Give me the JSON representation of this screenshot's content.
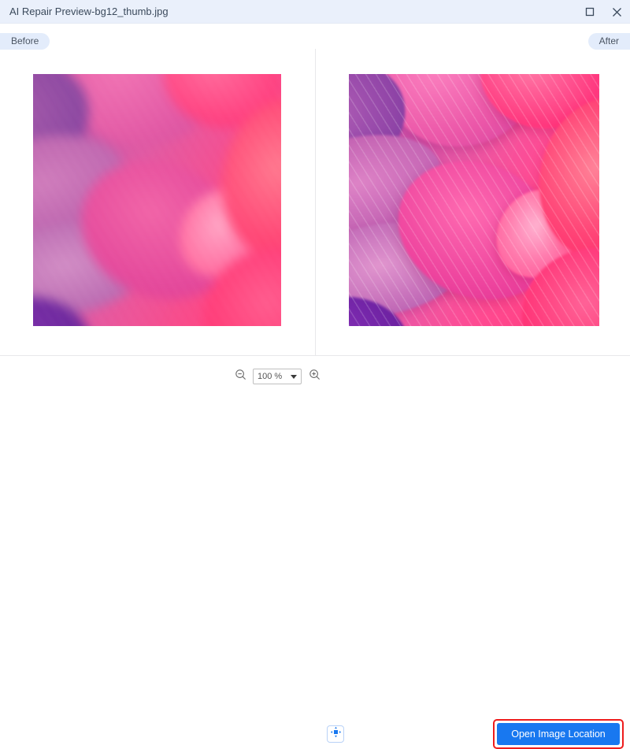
{
  "window": {
    "title": "AI Repair Preview-bg12_thumb.jpg",
    "maximize_icon": "maximize-square-icon",
    "close_icon": "close-x-icon"
  },
  "compare": {
    "before_label": "Before",
    "after_label": "After",
    "before_image_alt": "Blurry close-up of pink and magenta flower petals with purple shadows",
    "after_image_alt": "Sharpened close-up of pink and magenta flower petals with purple shadows"
  },
  "toolbar": {
    "zoom_out_icon": "magnifier-minus-icon",
    "zoom_in_icon": "magnifier-plus-icon",
    "zoom_value": "100 %",
    "zoom_caret_icon": "chevron-down-icon",
    "fit_icon": "fit-to-screen-icon",
    "open_location_label": "Open Image Location"
  },
  "colors": {
    "titlebar_bg": "#eaf0fb",
    "pill_bg": "#e3ecfb",
    "accent_blue": "#1878f0",
    "highlight_red": "#ee1c1c",
    "divider": "#e8e8ea"
  }
}
